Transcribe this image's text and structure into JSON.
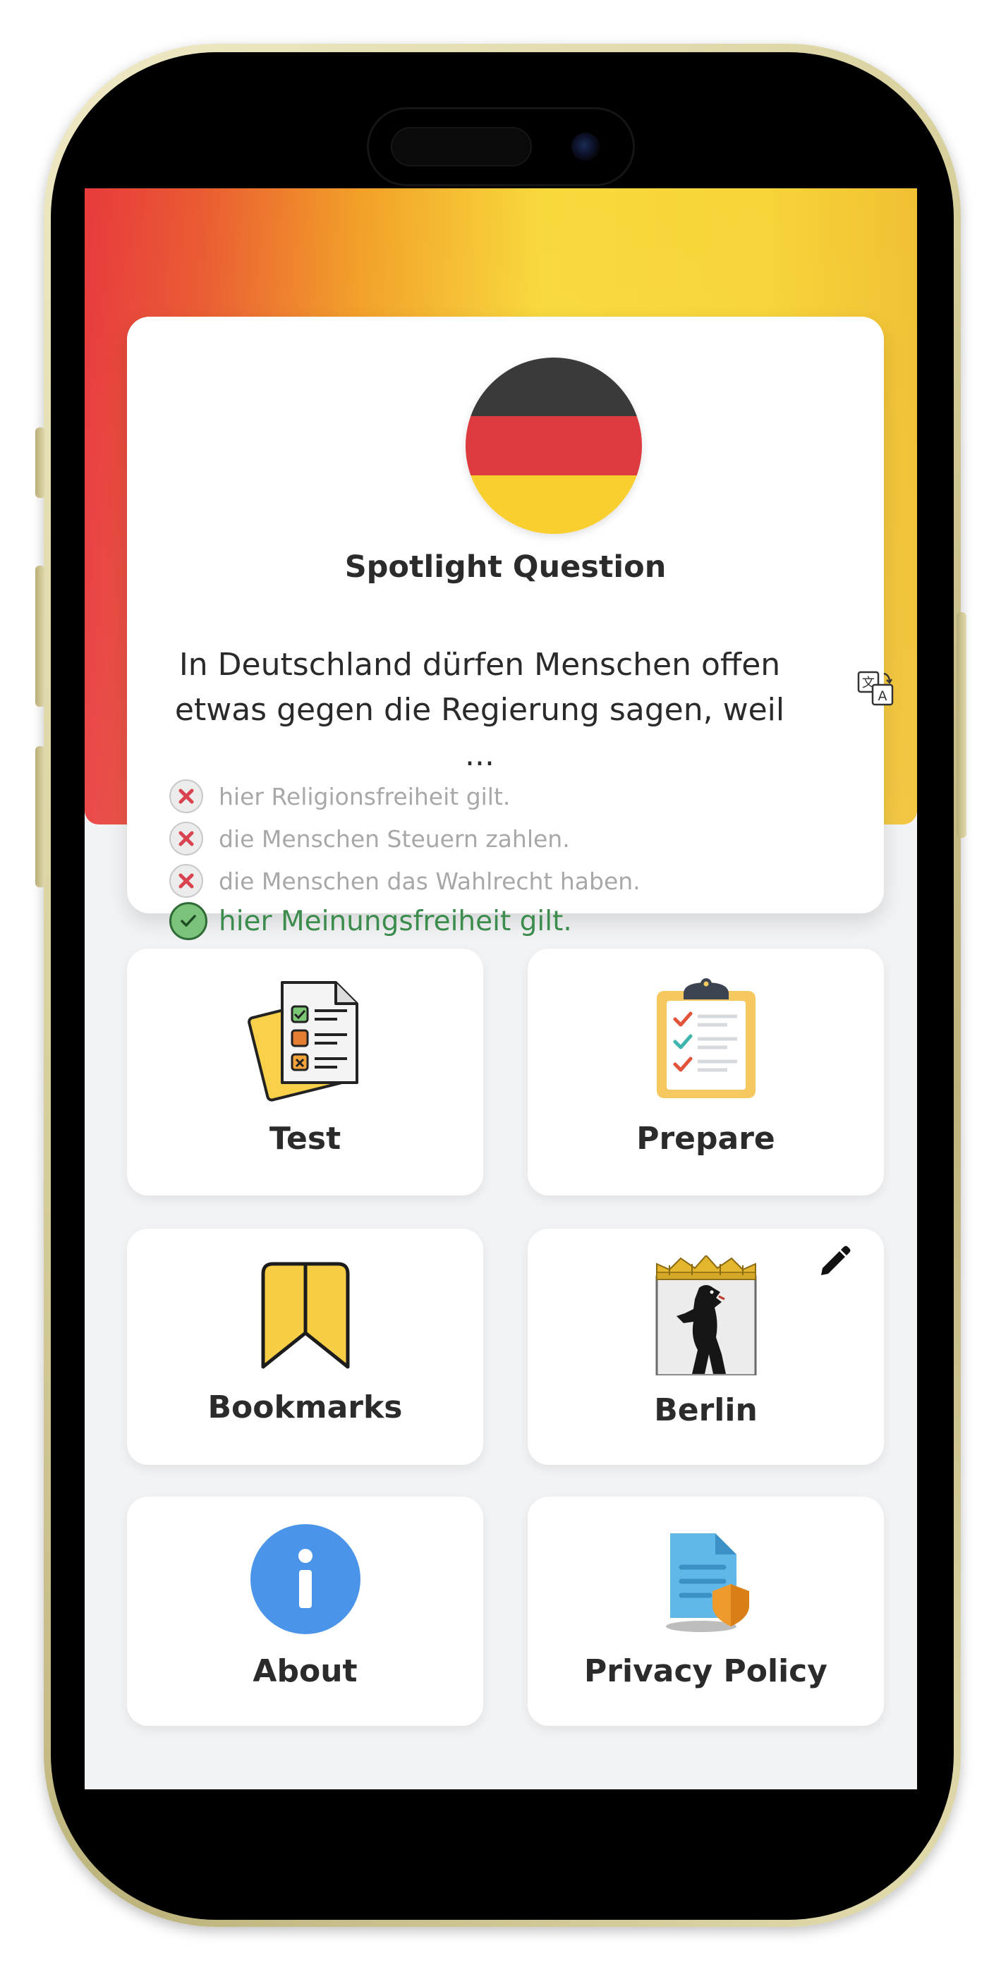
{
  "spotlight": {
    "title": "Spotlight Question",
    "question": "In Deutschland dürfen Menschen offen etwas gegen die Regierung sagen, weil ...",
    "answers": [
      {
        "text": "hier Religionsfreiheit gilt.",
        "correct": false
      },
      {
        "text": "die Menschen Steuern zahlen.",
        "correct": false
      },
      {
        "text": "die Menschen das Wahlrecht haben.",
        "correct": false
      },
      {
        "text": "hier Meinungsfreiheit gilt.",
        "correct": true
      }
    ]
  },
  "menu": {
    "test_label": "Test",
    "prepare_label": "Prepare",
    "bookmarks_label": "Bookmarks",
    "state_label": "Berlin",
    "about_label": "About",
    "privacy_label": "Privacy Policy"
  },
  "icons": {
    "flag": "germany-flag-icon",
    "translate": "translate-icon",
    "wrong": "x-circle-icon",
    "correct": "check-circle-icon",
    "test": "test-sheets-icon",
    "prepare": "clipboard-checklist-icon",
    "bookmarks": "bookmark-icon",
    "state": "berlin-coat-of-arms-icon",
    "edit": "pencil-icon",
    "about": "info-icon",
    "privacy": "privacy-document-icon"
  },
  "colors": {
    "correct_answer": "#3c8c4e",
    "wrong_answer": "#a8a8a8",
    "about_blue": "#4a95ea",
    "flag_black": "#3a3a3a",
    "flag_red": "#dd3b3f",
    "flag_gold": "#f8cf2e"
  }
}
